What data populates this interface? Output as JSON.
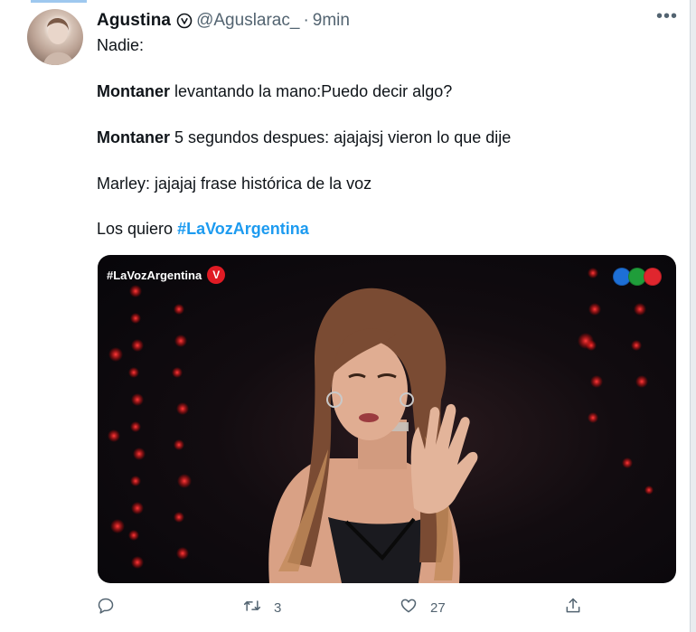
{
  "tweet": {
    "author_name": "Agustina",
    "handle": "@Aguslarac_",
    "separator": "·",
    "time": "9min",
    "lines": {
      "l1": "Nadie:",
      "l2_bold": "Montaner",
      "l2_rest": " levantando la mano:Puedo decir algo?",
      "l3_bold": "Montaner",
      "l3_rest": " 5 segundos despues: ajajajsj vieron lo que dije",
      "l4": "Marley: jajajaj frase histórica de la voz",
      "l5_text": "Los quiero ",
      "l5_hashtag": "#LaVozArgentina"
    }
  },
  "media": {
    "overlay_tag": "#LaVozArgentina",
    "logo_letter": "V",
    "channel_dots_colors": [
      "#1d6fd6",
      "#1f9d3a",
      "#e0262e"
    ]
  },
  "actions": {
    "reply_count": "",
    "retweet_count": "3",
    "like_count": "27"
  },
  "colors": {
    "accent": "#1d9bf0",
    "secondary_text": "#536471"
  }
}
